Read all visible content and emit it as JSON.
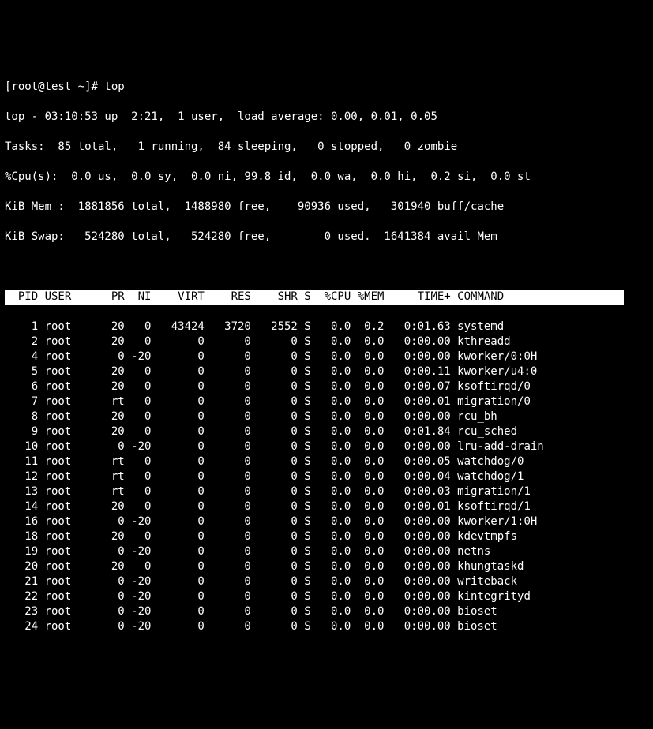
{
  "prompt": "[root@test ~]# top",
  "summary": {
    "line1": "top - 03:10:53 up  2:21,  1 user,  load average: 0.00, 0.01, 0.05",
    "line2": "Tasks:  85 total,   1 running,  84 sleeping,   0 stopped,   0 zombie",
    "line3": "%Cpu(s):  0.0 us,  0.0 sy,  0.0 ni, 99.8 id,  0.0 wa,  0.0 hi,  0.2 si,  0.0 st",
    "line4": "KiB Mem :  1881856 total,  1488980 free,    90936 used,   301940 buff/cache",
    "line5": "KiB Swap:   524280 total,   524280 free,        0 used.  1641384 avail Mem"
  },
  "header": "  PID USER      PR  NI    VIRT    RES    SHR S  %CPU %MEM     TIME+ COMMAND                  ",
  "rows": [
    {
      "pid": "1",
      "user": "root",
      "pr": "20",
      "ni": "0",
      "virt": "43424",
      "res": "3720",
      "shr": "2552",
      "s": "S",
      "cpu": "0.0",
      "mem": "0.2",
      "time": "0:01.63",
      "cmd": "systemd"
    },
    {
      "pid": "2",
      "user": "root",
      "pr": "20",
      "ni": "0",
      "virt": "0",
      "res": "0",
      "shr": "0",
      "s": "S",
      "cpu": "0.0",
      "mem": "0.0",
      "time": "0:00.00",
      "cmd": "kthreadd"
    },
    {
      "pid": "4",
      "user": "root",
      "pr": "0",
      "ni": "-20",
      "virt": "0",
      "res": "0",
      "shr": "0",
      "s": "S",
      "cpu": "0.0",
      "mem": "0.0",
      "time": "0:00.00",
      "cmd": "kworker/0:0H"
    },
    {
      "pid": "5",
      "user": "root",
      "pr": "20",
      "ni": "0",
      "virt": "0",
      "res": "0",
      "shr": "0",
      "s": "S",
      "cpu": "0.0",
      "mem": "0.0",
      "time": "0:00.11",
      "cmd": "kworker/u4:0"
    },
    {
      "pid": "6",
      "user": "root",
      "pr": "20",
      "ni": "0",
      "virt": "0",
      "res": "0",
      "shr": "0",
      "s": "S",
      "cpu": "0.0",
      "mem": "0.0",
      "time": "0:00.07",
      "cmd": "ksoftirqd/0"
    },
    {
      "pid": "7",
      "user": "root",
      "pr": "rt",
      "ni": "0",
      "virt": "0",
      "res": "0",
      "shr": "0",
      "s": "S",
      "cpu": "0.0",
      "mem": "0.0",
      "time": "0:00.01",
      "cmd": "migration/0"
    },
    {
      "pid": "8",
      "user": "root",
      "pr": "20",
      "ni": "0",
      "virt": "0",
      "res": "0",
      "shr": "0",
      "s": "S",
      "cpu": "0.0",
      "mem": "0.0",
      "time": "0:00.00",
      "cmd": "rcu_bh"
    },
    {
      "pid": "9",
      "user": "root",
      "pr": "20",
      "ni": "0",
      "virt": "0",
      "res": "0",
      "shr": "0",
      "s": "S",
      "cpu": "0.0",
      "mem": "0.0",
      "time": "0:01.84",
      "cmd": "rcu_sched"
    },
    {
      "pid": "10",
      "user": "root",
      "pr": "0",
      "ni": "-20",
      "virt": "0",
      "res": "0",
      "shr": "0",
      "s": "S",
      "cpu": "0.0",
      "mem": "0.0",
      "time": "0:00.00",
      "cmd": "lru-add-drain"
    },
    {
      "pid": "11",
      "user": "root",
      "pr": "rt",
      "ni": "0",
      "virt": "0",
      "res": "0",
      "shr": "0",
      "s": "S",
      "cpu": "0.0",
      "mem": "0.0",
      "time": "0:00.05",
      "cmd": "watchdog/0"
    },
    {
      "pid": "12",
      "user": "root",
      "pr": "rt",
      "ni": "0",
      "virt": "0",
      "res": "0",
      "shr": "0",
      "s": "S",
      "cpu": "0.0",
      "mem": "0.0",
      "time": "0:00.04",
      "cmd": "watchdog/1"
    },
    {
      "pid": "13",
      "user": "root",
      "pr": "rt",
      "ni": "0",
      "virt": "0",
      "res": "0",
      "shr": "0",
      "s": "S",
      "cpu": "0.0",
      "mem": "0.0",
      "time": "0:00.03",
      "cmd": "migration/1"
    },
    {
      "pid": "14",
      "user": "root",
      "pr": "20",
      "ni": "0",
      "virt": "0",
      "res": "0",
      "shr": "0",
      "s": "S",
      "cpu": "0.0",
      "mem": "0.0",
      "time": "0:00.01",
      "cmd": "ksoftirqd/1"
    },
    {
      "pid": "16",
      "user": "root",
      "pr": "0",
      "ni": "-20",
      "virt": "0",
      "res": "0",
      "shr": "0",
      "s": "S",
      "cpu": "0.0",
      "mem": "0.0",
      "time": "0:00.00",
      "cmd": "kworker/1:0H"
    },
    {
      "pid": "18",
      "user": "root",
      "pr": "20",
      "ni": "0",
      "virt": "0",
      "res": "0",
      "shr": "0",
      "s": "S",
      "cpu": "0.0",
      "mem": "0.0",
      "time": "0:00.00",
      "cmd": "kdevtmpfs"
    },
    {
      "pid": "19",
      "user": "root",
      "pr": "0",
      "ni": "-20",
      "virt": "0",
      "res": "0",
      "shr": "0",
      "s": "S",
      "cpu": "0.0",
      "mem": "0.0",
      "time": "0:00.00",
      "cmd": "netns"
    },
    {
      "pid": "20",
      "user": "root",
      "pr": "20",
      "ni": "0",
      "virt": "0",
      "res": "0",
      "shr": "0",
      "s": "S",
      "cpu": "0.0",
      "mem": "0.0",
      "time": "0:00.00",
      "cmd": "khungtaskd"
    },
    {
      "pid": "21",
      "user": "root",
      "pr": "0",
      "ni": "-20",
      "virt": "0",
      "res": "0",
      "shr": "0",
      "s": "S",
      "cpu": "0.0",
      "mem": "0.0",
      "time": "0:00.00",
      "cmd": "writeback"
    },
    {
      "pid": "22",
      "user": "root",
      "pr": "0",
      "ni": "-20",
      "virt": "0",
      "res": "0",
      "shr": "0",
      "s": "S",
      "cpu": "0.0",
      "mem": "0.0",
      "time": "0:00.00",
      "cmd": "kintegrityd"
    },
    {
      "pid": "23",
      "user": "root",
      "pr": "0",
      "ni": "-20",
      "virt": "0",
      "res": "0",
      "shr": "0",
      "s": "S",
      "cpu": "0.0",
      "mem": "0.0",
      "time": "0:00.00",
      "cmd": "bioset"
    },
    {
      "pid": "24",
      "user": "root",
      "pr": "0",
      "ni": "-20",
      "virt": "0",
      "res": "0",
      "shr": "0",
      "s": "S",
      "cpu": "0.0",
      "mem": "0.0",
      "time": "0:00.00",
      "cmd": "bioset"
    }
  ]
}
